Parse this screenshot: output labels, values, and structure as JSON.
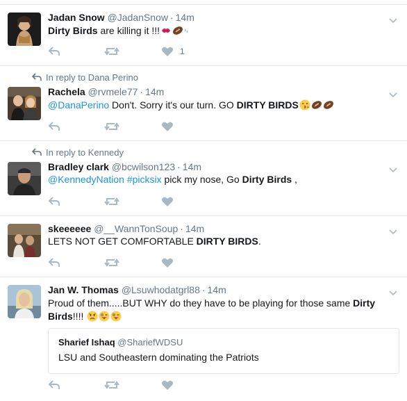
{
  "colors": {
    "link": "#1b95e0",
    "muted": "#657786",
    "divider": "#e6ecf0",
    "icon": "#aab8c2"
  },
  "tweets": [
    {
      "name": "Jadan Snow",
      "handle": "@JadanSnow",
      "time": "14m",
      "text": {
        "b1": "Dirty Birds",
        "t1": " are killing it !!!"
      },
      "emojis": [
        "kiss-mark",
        "football",
        "droplets"
      ],
      "likes": "1"
    },
    {
      "reply_context": "In reply to Dana Perino",
      "name": "Rachela",
      "handle": "@rvmele77",
      "time": "14m",
      "text": {
        "mention": "@DanaPerino",
        "t1": " Don't. Sorry it's our turn. GO ",
        "b1": "DIRTY BIRDS"
      },
      "emojis": [
        "winking-kiss-face",
        "football",
        "football"
      ]
    },
    {
      "reply_context": "In reply to Kennedy",
      "name": "Bradley clark",
      "handle": "@bcwilson123",
      "time": "14m",
      "text": {
        "mention": "@KennedyNation",
        "hashtag": "#picksix",
        "t1": " pick my nose, Go ",
        "b1": "Dirty Birds",
        "t2": " ,"
      }
    },
    {
      "name": "skeeeeee",
      "handle": "@__WannTonSoup",
      "time": "14m",
      "text": {
        "t1": "LETS NOT GET COMFORTABLE ",
        "b1": "DIRTY BIRDS",
        "t2": "."
      }
    },
    {
      "name": "Jan W. Thomas",
      "handle": "@Lsuwhodatgrl88",
      "time": "14m",
      "text": {
        "t1": "Proud of them.....BUT WHY do they have to be playing for those same ",
        "b1": "Dirty",
        "b2": "Birds",
        "t2": "!!!! "
      },
      "emojis": [
        "angry-face",
        "tongue-wink-face",
        "tongue-wink-face"
      ],
      "quote": {
        "name": "Sharief Ishaq",
        "handle": "@ShariefWDSU",
        "text": "LSU and Southeastern dominating the Patriots"
      }
    }
  ]
}
